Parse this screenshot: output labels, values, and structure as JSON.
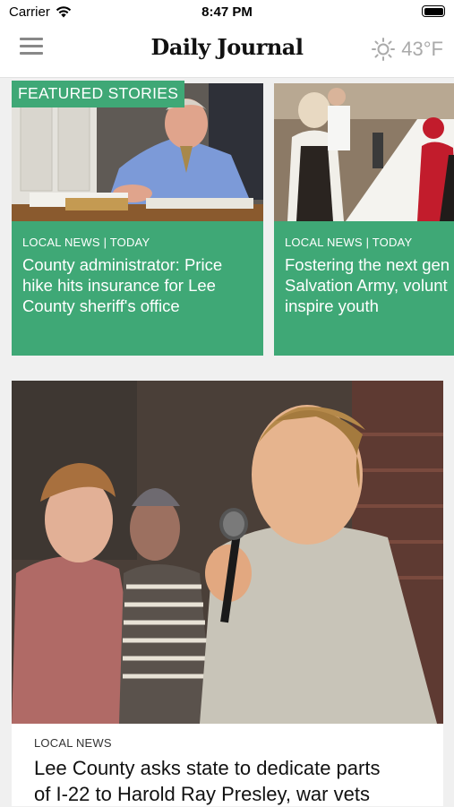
{
  "status_bar": {
    "carrier": "Carrier",
    "time": "8:47 PM"
  },
  "app_bar": {
    "masthead": "Daily Journal",
    "weather_temp": "43°F",
    "weather_icon": "sun-icon"
  },
  "featured": {
    "section_label": "FEATURED STORIES",
    "cards": [
      {
        "meta": "LOCAL NEWS | TODAY",
        "title": "County administrator: Price\nhike hits insurance for Lee\nCounty sheriff's office"
      },
      {
        "meta": "LOCAL NEWS | TODAY",
        "title": "Fostering the next gen\nSalvation Army, volunt\ninspire youth"
      }
    ]
  },
  "main_story": {
    "meta": "LOCAL NEWS",
    "title": "Lee County asks state to dedicate parts\nof I-22 to Harold Ray Presley, war vets"
  },
  "colors": {
    "accent_green": "#3fa876",
    "background": "#f0f0f0"
  }
}
